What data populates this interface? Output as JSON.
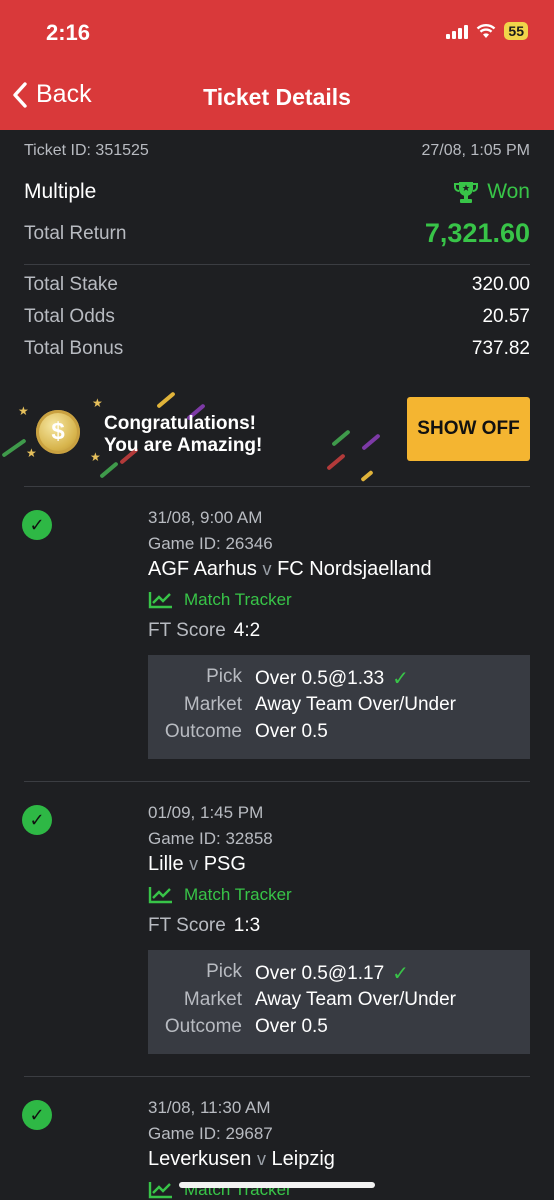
{
  "status_bar": {
    "time": "2:16",
    "battery": "55"
  },
  "header": {
    "back_label": "Back",
    "title": "Ticket Details"
  },
  "ticket": {
    "id_label": "Ticket ID: 351525",
    "datetime": "27/08, 1:05 PM",
    "type": "Multiple",
    "status": "Won",
    "total_return_label": "Total Return",
    "total_return": "7,321.60",
    "stake_label": "Total Stake",
    "stake": "320.00",
    "odds_label": "Total Odds",
    "odds": "20.57",
    "bonus_label": "Total Bonus",
    "bonus": "737.82"
  },
  "banner": {
    "line1": "Congratulations!",
    "line2": "You are Amazing!",
    "button": "SHOW OFF"
  },
  "labels": {
    "match_tracker": "Match Tracker",
    "ft_score": "FT Score",
    "pick": "Pick",
    "market": "Market",
    "outcome": "Outcome",
    "versus": "v"
  },
  "legs": [
    {
      "date": "31/08, 9:00 AM",
      "game_id": "Game ID: 26346",
      "home": "AGF Aarhus",
      "away": "FC Nordsjaelland",
      "score": "4:2",
      "pick": "Over 0.5@1.33",
      "market": "Away Team Over/Under",
      "outcome": "Over 0.5"
    },
    {
      "date": "01/09, 1:45 PM",
      "game_id": "Game ID: 32858",
      "home": "Lille",
      "away": "PSG",
      "score": "1:3",
      "pick": "Over 0.5@1.17",
      "market": "Away Team Over/Under",
      "outcome": "Over 0.5"
    },
    {
      "date": "31/08, 11:30 AM",
      "game_id": "Game ID: 29687",
      "home": "Leverkusen",
      "away": "Leipzig"
    }
  ],
  "colors": {
    "header": "#d9393a",
    "won": "#38c448",
    "button": "#f4b531",
    "background": "#1e1f22"
  }
}
